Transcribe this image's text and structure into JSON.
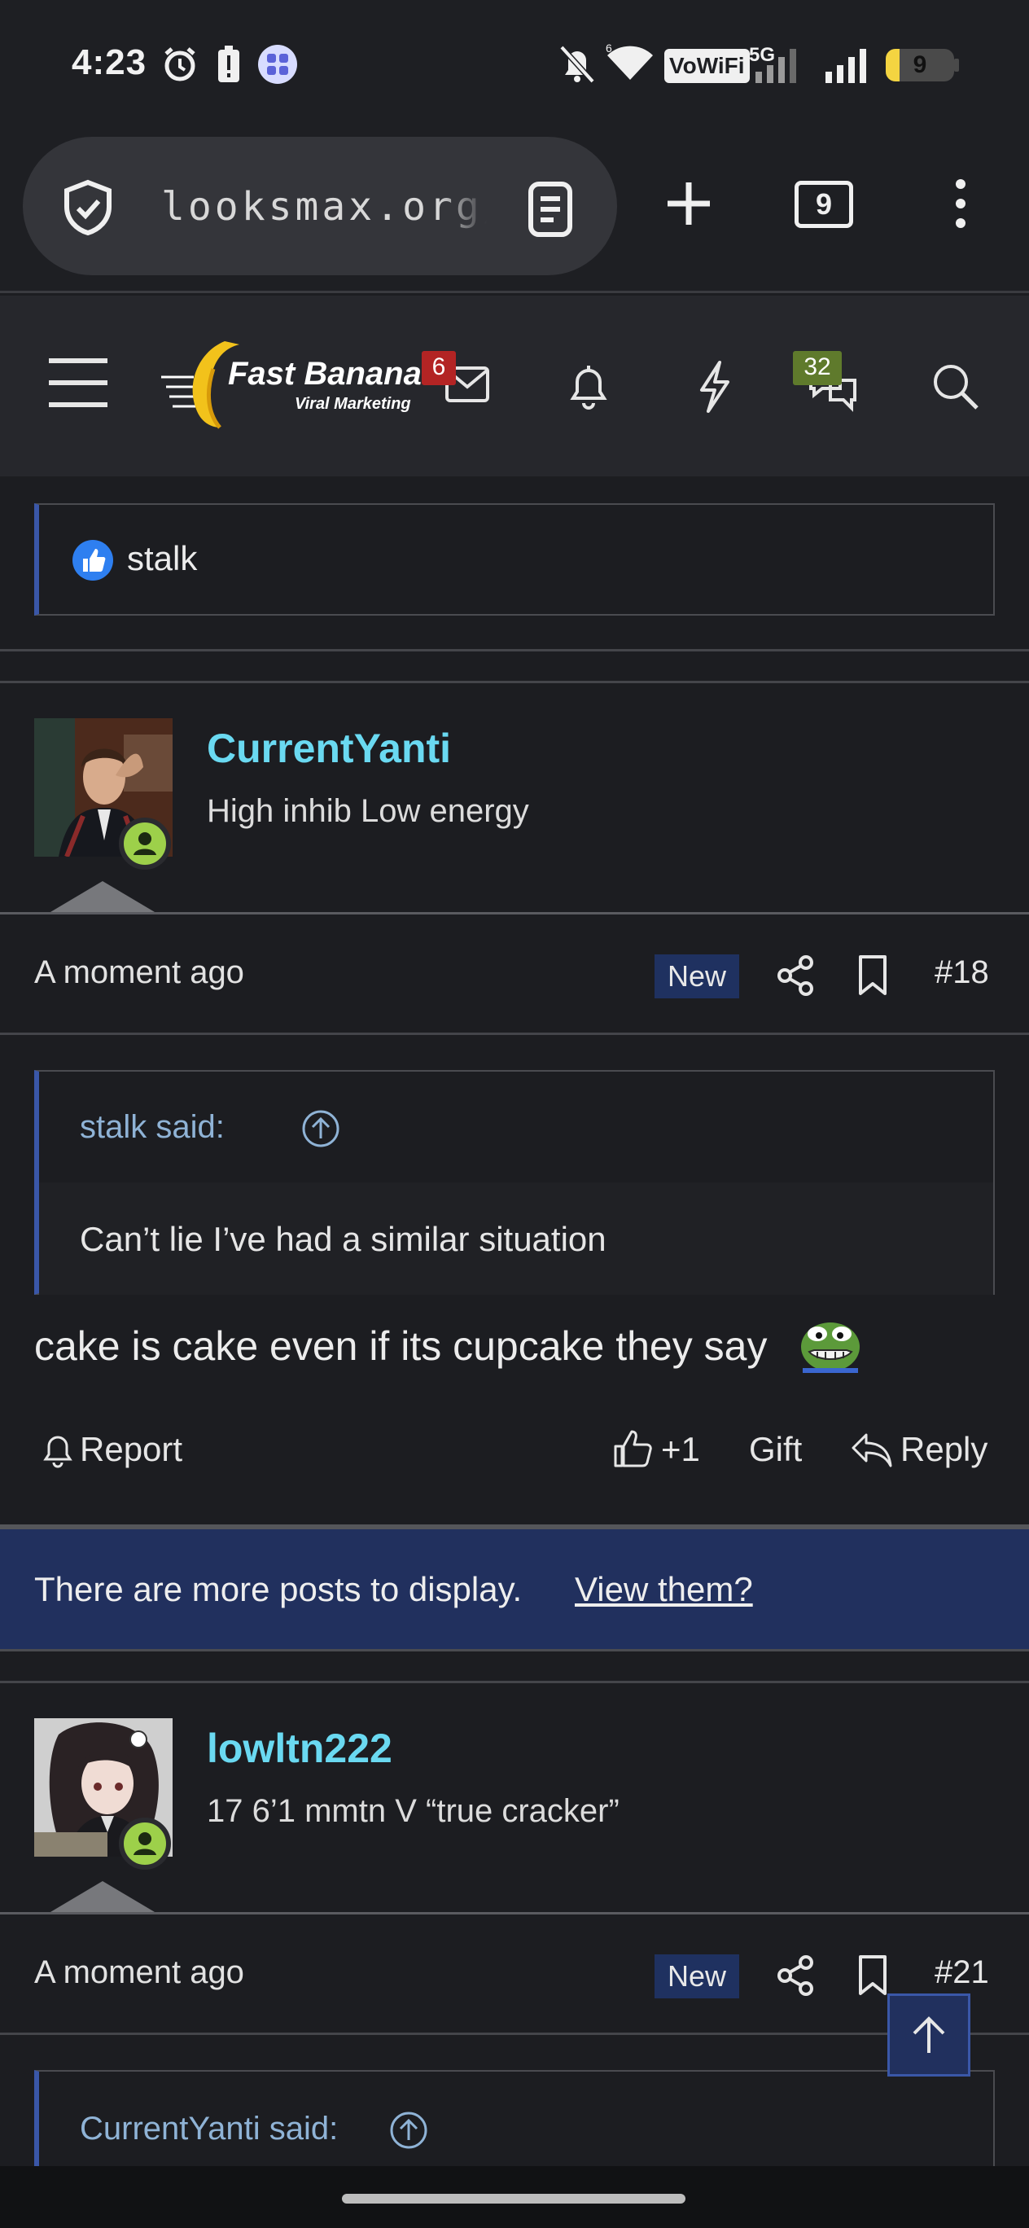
{
  "status_bar": {
    "time": "4:23",
    "vowifi": "VoWiFi",
    "network": "5G",
    "battery": "9"
  },
  "browser": {
    "url": "looksmax.org/t",
    "tab_count": "9"
  },
  "site_header": {
    "logo_title": "Fast Banana",
    "logo_subtitle": "Viral Marketing",
    "inbox_count": "6",
    "chat_count": "32"
  },
  "reaction_bar": {
    "user": "stalk"
  },
  "posts": [
    {
      "username": "CurrentYanti",
      "user_title": "High inhib Low energy",
      "time": "A moment ago",
      "new_label": "New",
      "post_number": "#18",
      "quote_author": "stalk said:",
      "quote_text": "Can’t lie I’ve had a similar situation",
      "body": "cake is cake even if its cupcake they say",
      "actions": {
        "report": "Report",
        "like_count": "+1",
        "gift": "Gift",
        "reply": "Reply"
      }
    },
    {
      "username": "lowltn222",
      "user_title": "17 6’1 mmtn V “true cracker”",
      "time": "A moment ago",
      "new_label": "New",
      "post_number": "#21",
      "quote_author": "CurrentYanti said:"
    }
  ],
  "more_posts": {
    "text": "There are more posts to display.",
    "link": "View them?"
  },
  "colors": {
    "username": "#6ad9f1",
    "accent_blue": "#3a57a8",
    "banner_bg": "#21305e",
    "inbox_badge": "#b32424",
    "chat_badge": "#5f7a2c"
  }
}
